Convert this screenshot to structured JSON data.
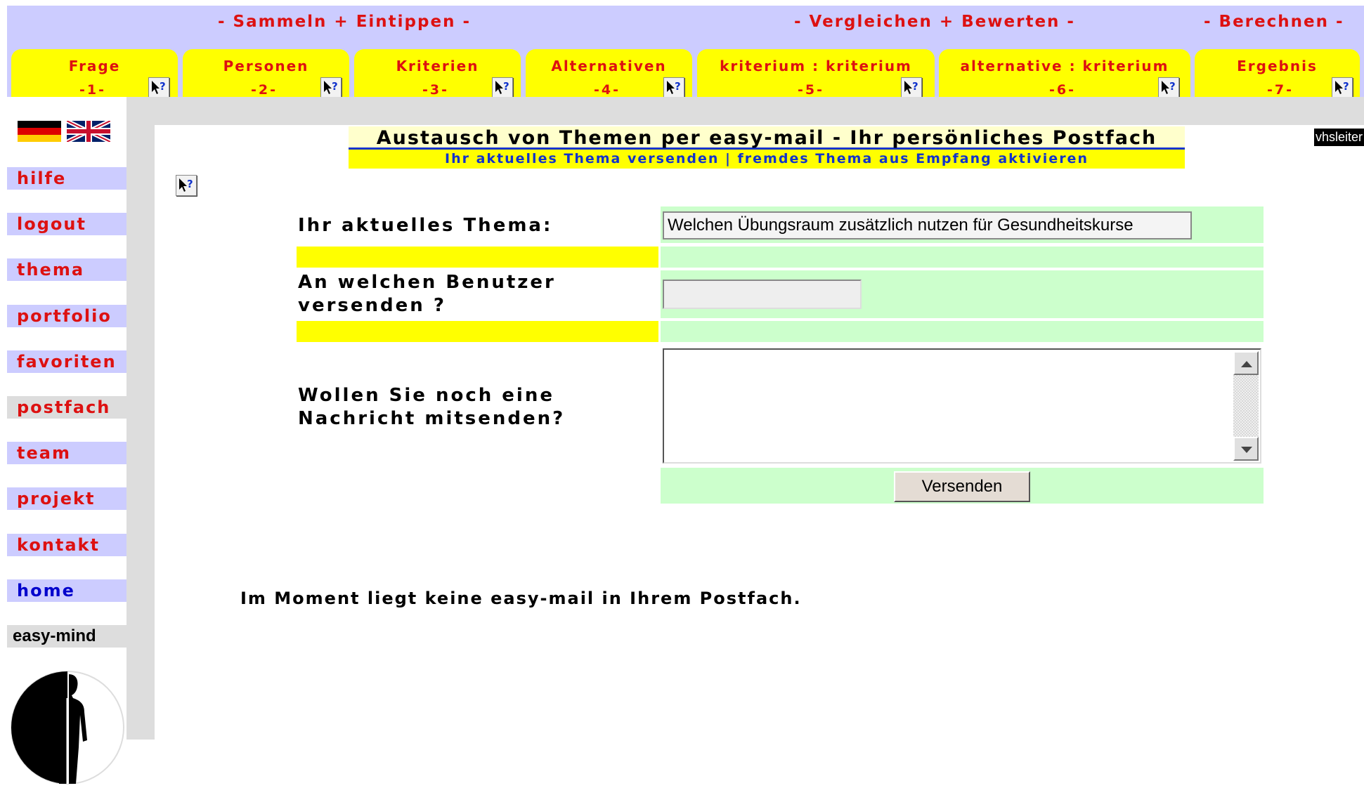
{
  "phases": {
    "collect": "- Sammeln + Eintippen -",
    "compare": "- Vergleichen + Bewerten -",
    "calculate": "- Berechnen -"
  },
  "steps": [
    {
      "label": "Frage",
      "number": "-1-"
    },
    {
      "label": "Personen",
      "number": "-2-"
    },
    {
      "label": "Kriterien",
      "number": "-3-"
    },
    {
      "label": "Alternativen",
      "number": "-4-"
    },
    {
      "label": "kriterium : kriterium",
      "number": "-5-"
    },
    {
      "label": "alternative : kriterium",
      "number": "-6-"
    },
    {
      "label": "Ergebnis",
      "number": "-7-"
    }
  ],
  "nav": {
    "items": [
      "hilfe",
      "logout",
      "thema",
      "portfolio",
      "favoriten",
      "postfach",
      "team",
      "projekt",
      "kontakt",
      "home"
    ],
    "brand": "easy-mind"
  },
  "user": "vhsleiter",
  "title": {
    "heading": "Austausch von Themen per easy-mail - Ihr persönliches Postfach",
    "subnav": "Ihr aktuelles Thema versenden | fremdes Thema aus Empfang aktivieren"
  },
  "form": {
    "topic_label": "Ihr aktuelles Thema:",
    "topic_value": "Welchen Übungsraum zusätzlich nutzen für Gesundheitskurse",
    "recipient_label_1": "An welchen Benutzer",
    "recipient_label_2": "versenden ?",
    "recipient_value": "",
    "message_label_1": "Wollen Sie noch eine",
    "message_label_2": "Nachricht mitsenden?",
    "message_value": "",
    "send_label": "Versenden"
  },
  "inbox_empty_note": "Im Moment liegt keine easy-mail in Ihrem Postfach.",
  "colors": {
    "phase_band": "#ccccff",
    "tab": "#ffff00",
    "accent_red": "#dd1111",
    "link_blue": "#1133cc",
    "form_green": "#ccffcc"
  }
}
